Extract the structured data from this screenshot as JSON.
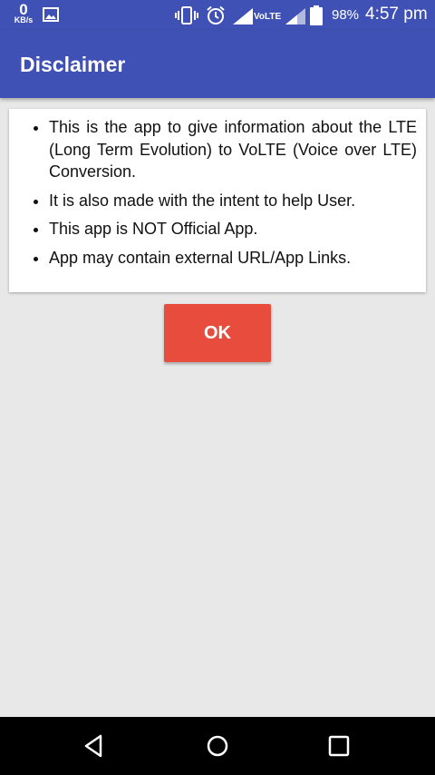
{
  "status_bar": {
    "net_speed_value": "0",
    "net_speed_unit": "KB/s",
    "network_label": "VoLTE",
    "battery_percent": "98%",
    "time": "4:57 pm",
    "icons": [
      "image-icon",
      "vibrate-icon",
      "alarm-icon",
      "signal-icon",
      "signal-icon",
      "battery-icon"
    ]
  },
  "app_bar": {
    "title": "Disclaimer",
    "color": "#3f51b5"
  },
  "disclaimer": {
    "items": [
      "This is the app to give information about the LTE (Long Term Evolution) to VoLTE (Voice over LTE) Conversion.",
      "It is also made with the intent to help User.",
      "This app is NOT Official App.",
      "App may contain external URL/App Links."
    ]
  },
  "ok_button": {
    "label": "OK",
    "color": "#e74c3c"
  },
  "nav_bar": {
    "icons": [
      "back-icon",
      "home-icon",
      "recent-apps-icon"
    ]
  }
}
